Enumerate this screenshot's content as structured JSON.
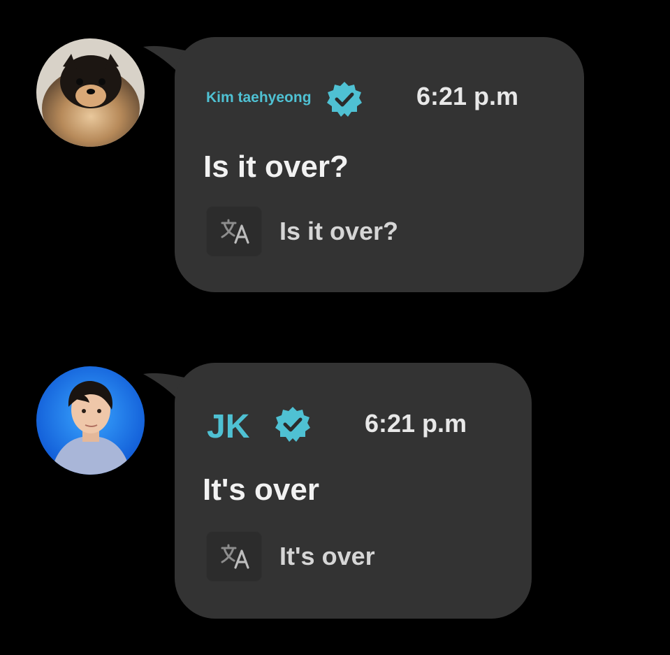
{
  "messages": [
    {
      "sender": "Kim taehyeong",
      "verified": true,
      "time": "6:21 p.m",
      "text": "Is it over?",
      "translation": "Is it over?",
      "avatar_icon": "pomeranian-dog-photo"
    },
    {
      "sender": "JK",
      "verified": true,
      "time": "6:21 p.m",
      "text": "It's over",
      "translation": "It's over",
      "avatar_icon": "person-blue-background-photo"
    }
  ],
  "colors": {
    "background": "#000000",
    "bubble": "#333333",
    "accent": "#4fc1d3",
    "text": "#f2f2f2",
    "translation_text": "#d6d6d6"
  },
  "icons": {
    "verified": "verified-badge-icon",
    "translate": "translate-icon"
  }
}
